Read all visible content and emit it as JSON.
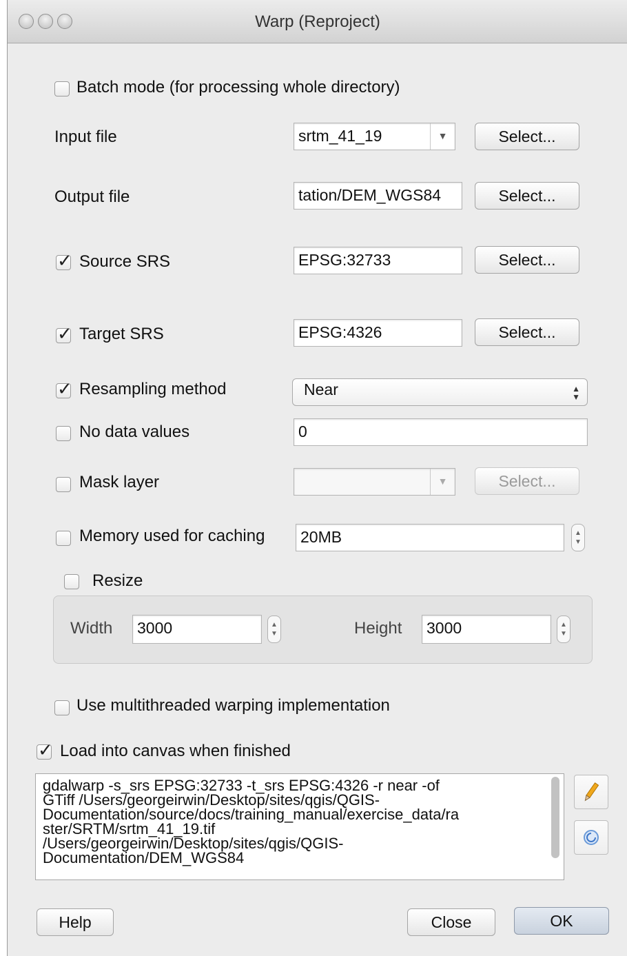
{
  "window": {
    "title": "Warp (Reproject)"
  },
  "batch_mode": {
    "label": "Batch mode (for processing whole directory)",
    "checked": false
  },
  "input_file": {
    "label": "Input file",
    "value": "srtm_41_19",
    "select_label": "Select..."
  },
  "output_file": {
    "label": "Output file",
    "value": "tation/DEM_WGS84",
    "select_label": "Select..."
  },
  "source_srs": {
    "label": "Source SRS",
    "checked": true,
    "value": "EPSG:32733",
    "select_label": "Select..."
  },
  "target_srs": {
    "label": "Target SRS",
    "checked": true,
    "value": "EPSG:4326",
    "select_label": "Select..."
  },
  "resampling": {
    "label": "Resampling method",
    "checked": true,
    "value": "Near"
  },
  "no_data": {
    "label": "No data values",
    "checked": false,
    "value": "0"
  },
  "mask_layer": {
    "label": "Mask layer",
    "checked": false,
    "value": "",
    "select_label": "Select..."
  },
  "memory": {
    "label": "Memory used for caching",
    "checked": false,
    "value": "20MB"
  },
  "resize": {
    "label": "Resize",
    "checked": false,
    "width_label": "Width",
    "width_value": "3000",
    "height_label": "Height",
    "height_value": "3000"
  },
  "multithread": {
    "label": "Use multithreaded warping implementation",
    "checked": false
  },
  "load_canvas": {
    "label": "Load into canvas when finished",
    "checked": true
  },
  "command": {
    "lines": [
      "gdalwarp -s_srs EPSG:32733 -t_srs EPSG:4326 -r near -of",
      "GTiff /Users/georgeirwin/Desktop/sites/qgis/QGIS-",
      "Documentation/source/docs/training_manual/exercise_data/ra",
      "ster/SRTM/srtm_41_19.tif",
      "/Users/georgeirwin/Desktop/sites/qgis/QGIS-",
      "Documentation/DEM_WGS84"
    ]
  },
  "icons": {
    "edit": "pencil-icon",
    "reset": "reset-icon"
  },
  "buttons": {
    "help": "Help",
    "close": "Close",
    "ok": "OK"
  }
}
